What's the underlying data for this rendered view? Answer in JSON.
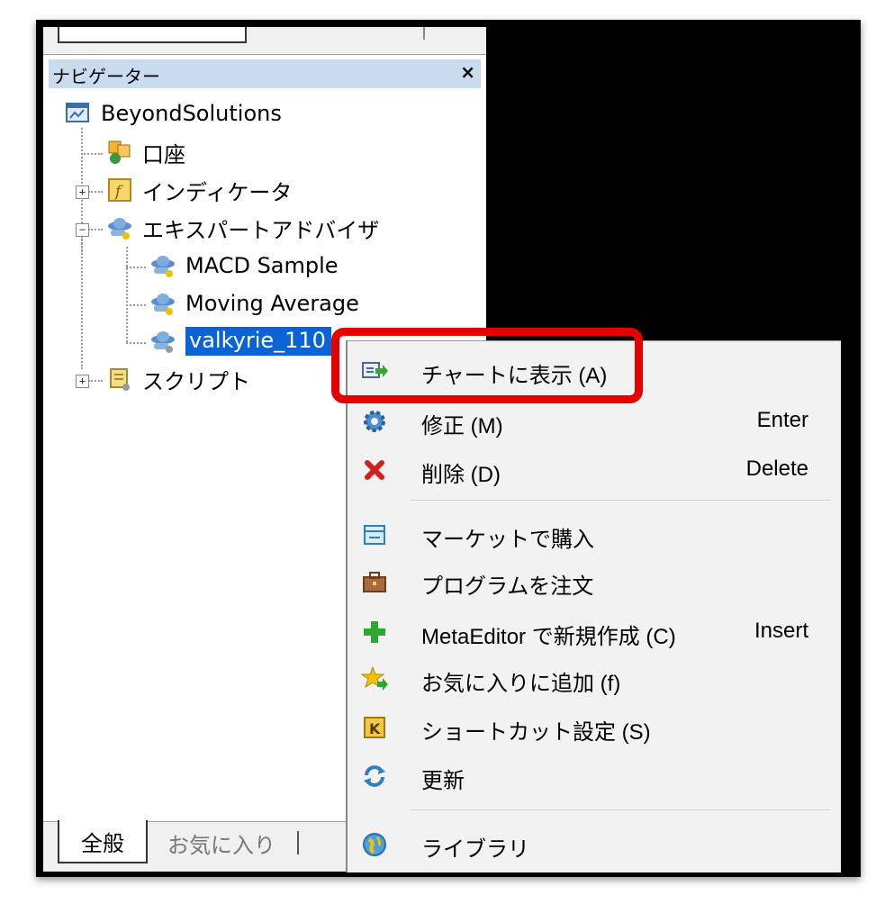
{
  "window": {
    "title": "ナビゲーター",
    "close_glyph": "×"
  },
  "tree": {
    "root": {
      "label": "BeyondSolutions",
      "icon": "terminal-icon"
    },
    "items": [
      {
        "label": "口座",
        "icon": "accounts-icon"
      },
      {
        "label": "インディケータ",
        "icon": "indicator-icon",
        "expander": "+"
      },
      {
        "label": "エキスパートアドバイザ",
        "icon": "expert-advisor-icon",
        "expander": "−"
      },
      {
        "label": "MACD Sample",
        "icon": "expert-advisor-icon"
      },
      {
        "label": "Moving Average",
        "icon": "expert-advisor-icon"
      },
      {
        "label": "valkyrie_110",
        "icon": "expert-advisor-icon",
        "selected": true
      },
      {
        "label": "スクリプト",
        "icon": "script-icon",
        "expander": "+"
      }
    ]
  },
  "bottom_tabs": [
    {
      "label": "全般",
      "active": true
    },
    {
      "label": "お気に入り",
      "active": false
    }
  ],
  "context_menu": {
    "items": [
      {
        "label": "チャートに表示 (A)",
        "shortcut": "",
        "icon": "attach-to-chart-icon",
        "highlighted": true
      },
      {
        "label": "修正 (M)",
        "shortcut": "Enter",
        "icon": "modify-gear-icon"
      },
      {
        "label": "削除 (D)",
        "shortcut": "Delete",
        "icon": "delete-x-icon"
      },
      {
        "label": "マーケットで購入",
        "shortcut": "",
        "icon": "market-icon"
      },
      {
        "label": "プログラムを注文",
        "shortcut": "",
        "icon": "briefcase-icon"
      },
      {
        "label": "MetaEditor で新規作成 (C)",
        "shortcut": "Insert",
        "icon": "plus-icon"
      },
      {
        "label": "お気に入りに追加 (f)",
        "shortcut": "",
        "icon": "star-icon"
      },
      {
        "label": "ショートカット設定 (S)",
        "shortcut": "",
        "icon": "hotkey-k-icon"
      },
      {
        "label": "更新",
        "shortcut": "",
        "icon": "refresh-icon"
      },
      {
        "label": "ライブラリ",
        "shortcut": "",
        "icon": "globe-icon"
      }
    ]
  },
  "colors": {
    "highlight_border": "#e60000",
    "selection": "#0a64d8",
    "title_bar": "#c9dcef"
  }
}
